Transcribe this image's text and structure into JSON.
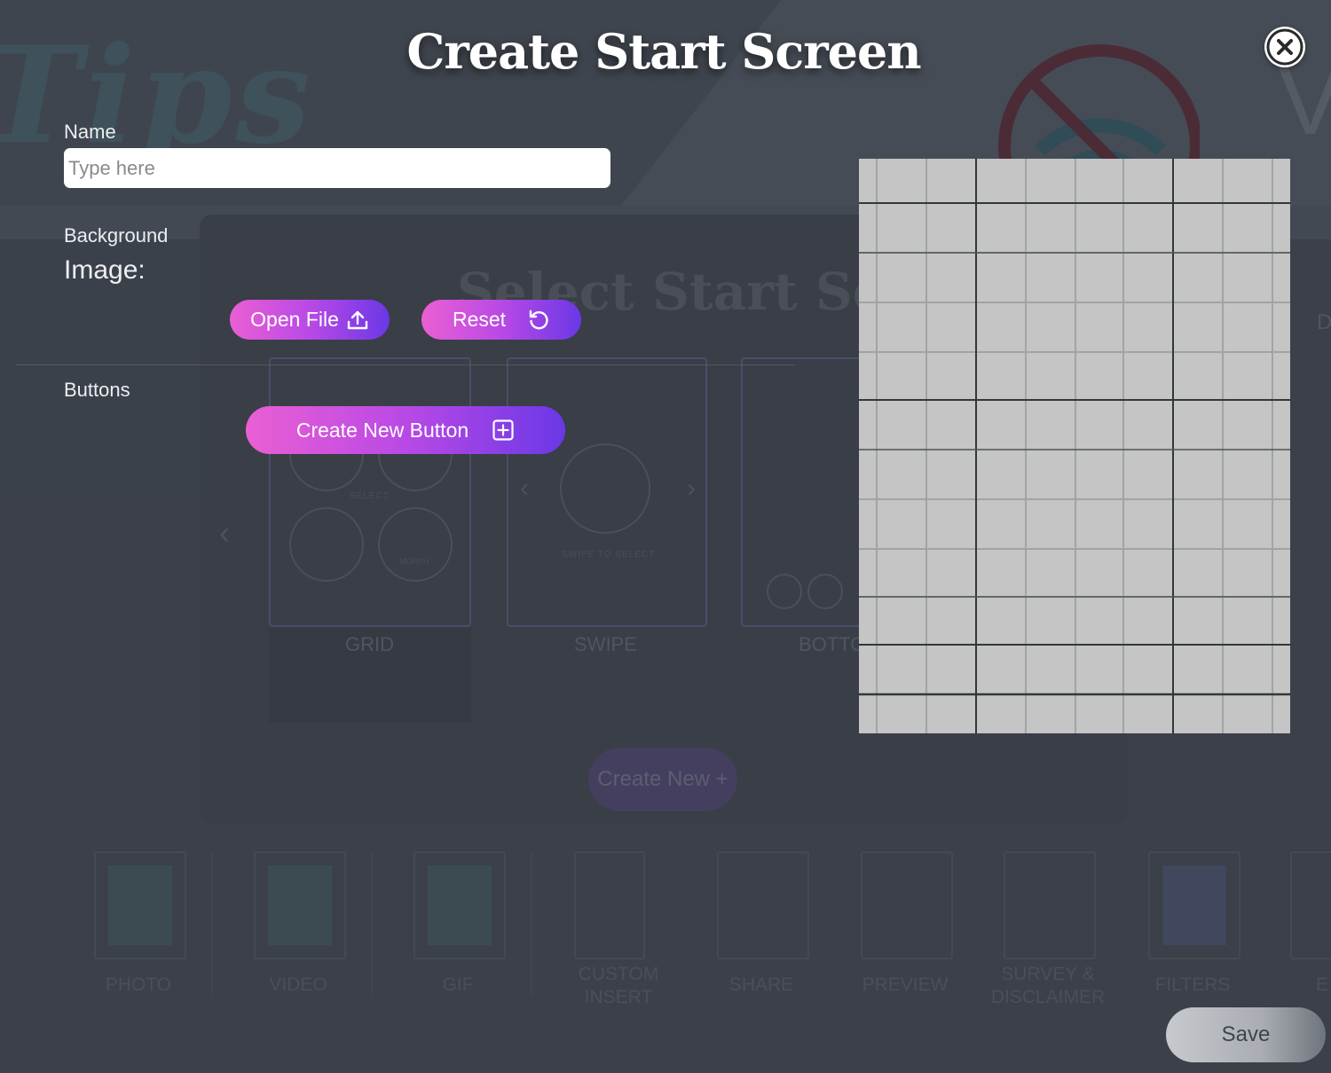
{
  "modal": {
    "title": "Create Start Screen",
    "close_icon": "close-icon"
  },
  "form": {
    "name_label": "Name",
    "name_value": "",
    "name_placeholder": "Type here",
    "background_label": "Background",
    "image_label": "Image:",
    "open_file_label": "Open File",
    "open_file_icon": "upload-icon",
    "reset_label": "Reset",
    "reset_icon": "reset-icon",
    "buttons_label": "Buttons",
    "create_button_label": "Create New Button",
    "create_button_icon": "plus-square-icon",
    "save_label": "Save"
  },
  "background_app": {
    "watermark_text": "Tips",
    "modal_title": "Select Start Screen",
    "layouts": [
      {
        "label": "GRID"
      },
      {
        "label": "SWIPE"
      },
      {
        "label": "BOTTO"
      }
    ],
    "grid_select_text": "SELECT",
    "grid_morph_text": "MORPH",
    "swipe_text": "SWIPE TO SELECT",
    "right_partial_text": "D",
    "create_new_label": "Create New +",
    "tools": [
      {
        "label": "PHOTO"
      },
      {
        "label": "VIDEO"
      },
      {
        "label": "GIF"
      },
      {
        "label": "CUSTOM INSERT"
      },
      {
        "label": "SHARE"
      },
      {
        "label": "PREVIEW"
      },
      {
        "label": "SURVEY & DISCLAIMER"
      },
      {
        "label": "FILTERS"
      },
      {
        "label": "E"
      }
    ]
  },
  "colors": {
    "button_gradient_start": "#ea5fd3",
    "button_gradient_end": "#6a38e6",
    "overlay": "#3b4049",
    "preview_bg": "#c4c5c4"
  }
}
